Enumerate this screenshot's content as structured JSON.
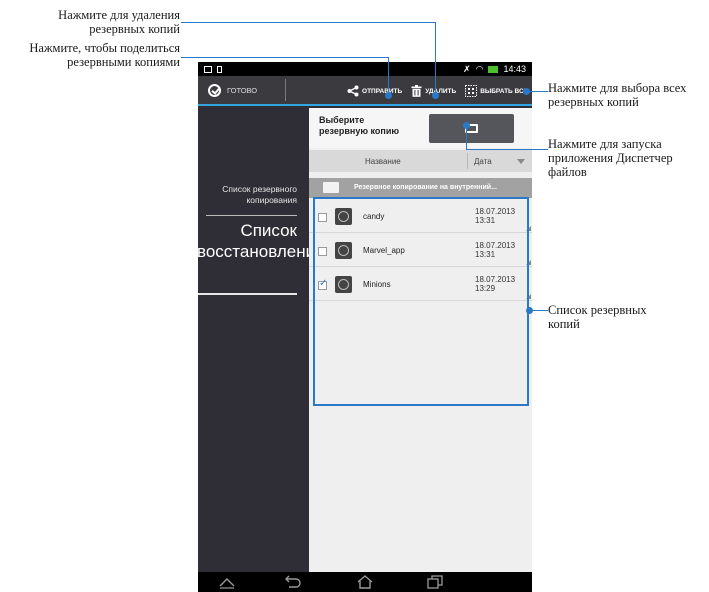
{
  "callouts": {
    "delete": "Нажмите для удаления резервных копий",
    "share": "Нажмите, чтобы поделиться резервными копиями",
    "select_all": "Нажмите для выбора всех резервных копий",
    "file_manager": "Нажмите для запуска приложения Диспетчер файлов",
    "backup_list": "Список резервных копий"
  },
  "status_bar": {
    "time": "14:43"
  },
  "action_bar": {
    "done_label": "ГОТОВО",
    "send_label": "ОТПРАВИТЬ",
    "delete_label": "УДАЛИТЬ",
    "select_all_label": "ВЫБРАТЬ ВСЕ"
  },
  "sidebar": {
    "backup_list_label": "Список резервного копирования",
    "restore_list_label": "Список восстановления"
  },
  "content": {
    "choose_backup_label": "Выберите резервную копию",
    "column_name": "Название",
    "column_date": "Дата",
    "folder_text": "Резервное копирование на внутренний...",
    "rows": [
      {
        "name": "candy",
        "date": "18.07.2013",
        "time": "13:31",
        "checked": false
      },
      {
        "name": "Marvel_app",
        "date": "18.07.2013",
        "time": "13:31",
        "checked": false
      },
      {
        "name": "Minions",
        "date": "18.07.2013",
        "time": "13:29",
        "checked": true
      }
    ]
  },
  "colors": {
    "accent": "#2a78c8",
    "actionbar_underline": "#33a5e0",
    "sidebar": "#2f2e36"
  }
}
